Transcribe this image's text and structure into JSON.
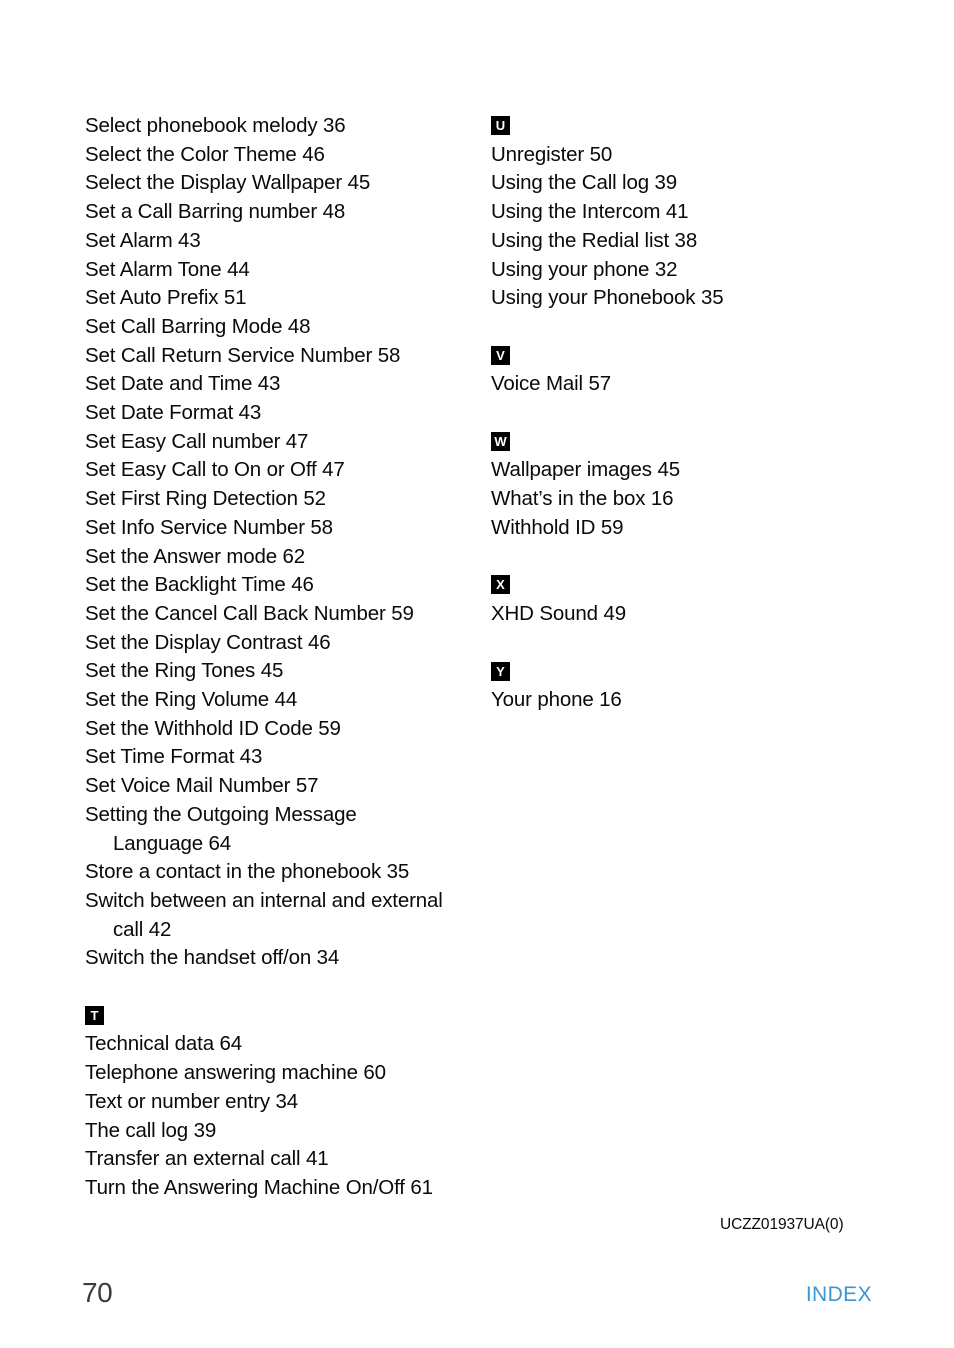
{
  "document": {
    "doc_code": "UCZZ01937UA(0)",
    "page_number": "70",
    "footer_label": "INDEX"
  },
  "columns": {
    "left": [
      {
        "letter": null,
        "entries": [
          {
            "text": "Select phonebook melody 36",
            "continuation": false
          },
          {
            "text": "Select the Color Theme 46",
            "continuation": false
          },
          {
            "text": "Select the Display Wallpaper 45",
            "continuation": false
          },
          {
            "text": "Set a Call Barring number 48",
            "continuation": false
          },
          {
            "text": "Set Alarm 43",
            "continuation": false
          },
          {
            "text": "Set Alarm Tone 44",
            "continuation": false
          },
          {
            "text": "Set Auto Prefix 51",
            "continuation": false
          },
          {
            "text": "Set Call Barring Mode 48",
            "continuation": false
          },
          {
            "text": "Set Call Return Service Number 58",
            "continuation": false
          },
          {
            "text": "Set Date and Time 43",
            "continuation": false
          },
          {
            "text": "Set Date Format 43",
            "continuation": false
          },
          {
            "text": "Set Easy Call number 47",
            "continuation": false
          },
          {
            "text": "Set Easy Call to On or Off 47",
            "continuation": false
          },
          {
            "text": "Set First Ring Detection 52",
            "continuation": false
          },
          {
            "text": "Set Info Service Number 58",
            "continuation": false
          },
          {
            "text": "Set the Answer mode 62",
            "continuation": false
          },
          {
            "text": "Set the Backlight Time 46",
            "continuation": false
          },
          {
            "text": "Set the Cancel Call Back Number 59",
            "continuation": false
          },
          {
            "text": "Set the Display Contrast 46",
            "continuation": false
          },
          {
            "text": "Set the Ring Tones 45",
            "continuation": false
          },
          {
            "text": "Set the Ring Volume 44",
            "continuation": false
          },
          {
            "text": "Set the Withhold ID Code 59",
            "continuation": false
          },
          {
            "text": "Set Time Format 43",
            "continuation": false
          },
          {
            "text": "Set Voice Mail Number 57",
            "continuation": false
          },
          {
            "text": "Setting the Outgoing Message",
            "continuation": false
          },
          {
            "text": "Language 64",
            "continuation": true
          },
          {
            "text": "Store a contact in the phonebook 35",
            "continuation": false
          },
          {
            "text": "Switch between an internal and external",
            "continuation": false
          },
          {
            "text": "call 42",
            "continuation": true
          },
          {
            "text": "Switch the handset off/on 34",
            "continuation": false
          }
        ]
      },
      {
        "letter": "T",
        "entries": [
          {
            "text": "Technical data 64",
            "continuation": false
          },
          {
            "text": "Telephone answering machine 60",
            "continuation": false
          },
          {
            "text": "Text or number entry 34",
            "continuation": false
          },
          {
            "text": "The call log 39",
            "continuation": false
          },
          {
            "text": "Transfer an external call 41",
            "continuation": false
          },
          {
            "text": "Turn the Answering Machine On/Off 61",
            "continuation": false
          }
        ]
      }
    ],
    "right": [
      {
        "letter": "U",
        "entries": [
          {
            "text": "Unregister 50",
            "continuation": false
          },
          {
            "text": "Using the Call log 39",
            "continuation": false
          },
          {
            "text": "Using the Intercom 41",
            "continuation": false
          },
          {
            "text": "Using the Redial list 38",
            "continuation": false
          },
          {
            "text": "Using your phone 32",
            "continuation": false
          },
          {
            "text": "Using your Phonebook 35",
            "continuation": false
          }
        ]
      },
      {
        "letter": "V",
        "entries": [
          {
            "text": "Voice Mail 57",
            "continuation": false
          }
        ]
      },
      {
        "letter": "W",
        "entries": [
          {
            "text": "Wallpaper images 45",
            "continuation": false
          },
          {
            "text": "What’s in the box 16",
            "continuation": false
          },
          {
            "text": "Withhold ID 59",
            "continuation": false
          }
        ]
      },
      {
        "letter": "X",
        "entries": [
          {
            "text": "XHD Sound 49",
            "continuation": false
          }
        ]
      },
      {
        "letter": "Y",
        "entries": [
          {
            "text": "Your phone 16",
            "continuation": false
          }
        ]
      }
    ]
  }
}
